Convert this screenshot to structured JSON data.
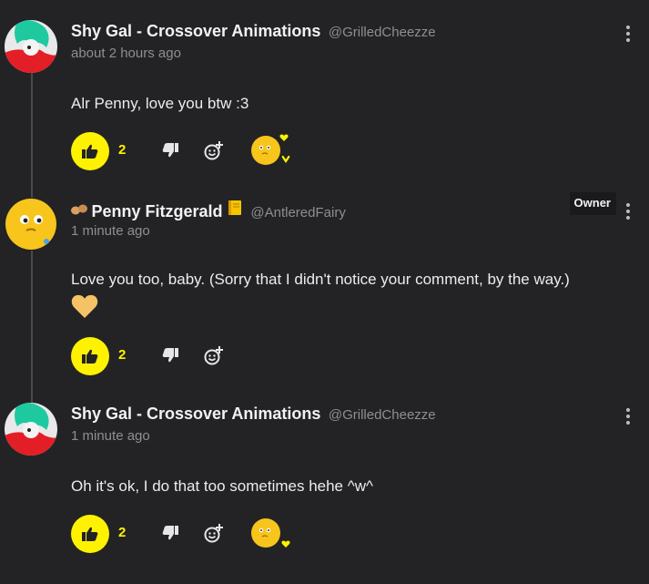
{
  "comments": [
    {
      "author": "Shy Gal - Crossover Animations",
      "handle": "@GrilledCheezze",
      "time": "about 2 hours ago",
      "text": "Alr Penny, love you btw :3",
      "likes": "2",
      "has_reaction": true
    },
    {
      "author": "Penny Fitzgerald",
      "handle": "@AntleredFairy",
      "time": "1 minute ago",
      "text": "Love you too, baby. (Sorry that I didn't notice your comment, by the way.)",
      "badge": "Owner",
      "likes": "2",
      "has_reaction": false
    },
    {
      "author": "Shy Gal - Crossover Animations",
      "handle": "@GrilledCheezze",
      "time": "1 minute ago",
      "text": "Oh it's ok, I do that too sometimes hehe ^w^",
      "likes": "2",
      "has_reaction": true
    }
  ],
  "colors": {
    "accent": "#fff200",
    "background": "#232325",
    "muted": "#8e8e93",
    "heart": "#f6c266"
  },
  "icons": [
    "thumbs-up-icon",
    "thumbs-down-icon",
    "add-reaction-icon",
    "more-vertical-icon",
    "peanut-icon",
    "notebook-icon",
    "heart-icon"
  ]
}
